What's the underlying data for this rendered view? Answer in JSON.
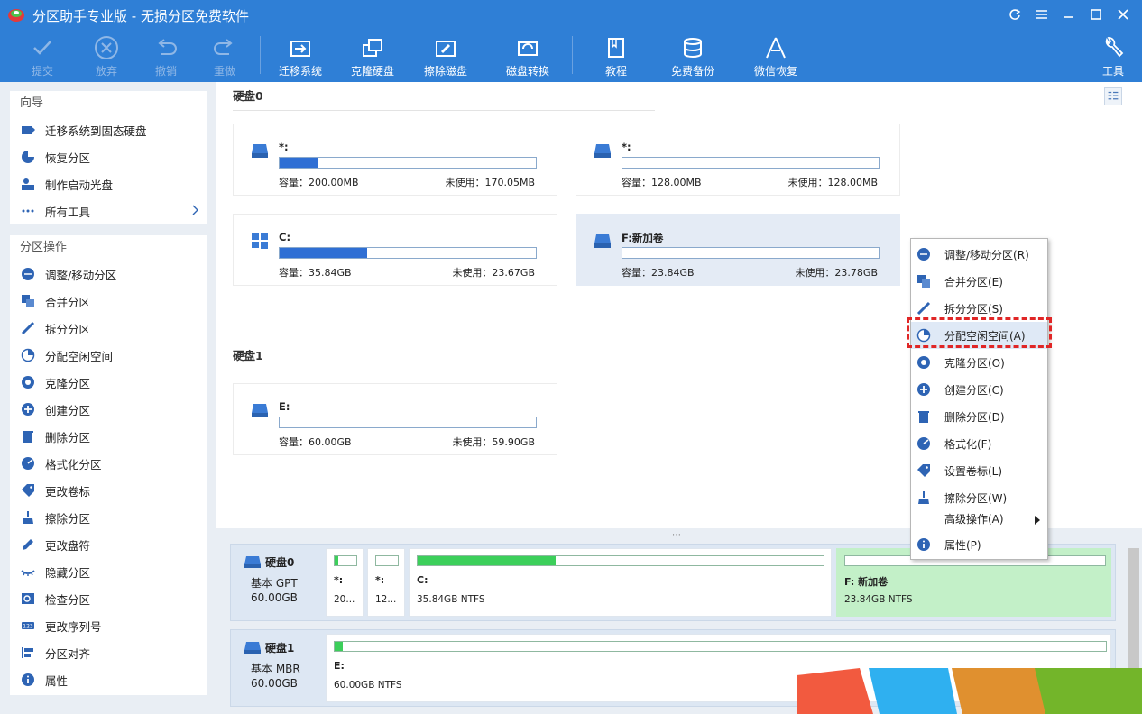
{
  "app": {
    "title": "分区助手专业版 - 无损分区免费软件"
  },
  "toolbar": {
    "commit": "提交",
    "discard": "放弃",
    "undo": "撤销",
    "redo": "重做",
    "migrate": "迁移系统",
    "clone_disk": "克隆硬盘",
    "wipe_disk": "擦除磁盘",
    "convert_disk": "磁盘转换",
    "tutorial": "教程",
    "backup": "免费备份",
    "wechat_recover": "微信恢复",
    "tools": "工具"
  },
  "sidebar": {
    "wizard": {
      "header": "向导",
      "items": [
        {
          "label": "迁移系统到固态硬盘",
          "icon": "migrate-icon"
        },
        {
          "label": "恢复分区",
          "icon": "recover-icon"
        },
        {
          "label": "制作启动光盘",
          "icon": "bootdisk-icon"
        },
        {
          "label": "所有工具",
          "icon": "tools-icon"
        }
      ]
    },
    "ops": {
      "header": "分区操作",
      "items": [
        {
          "label": "调整/移动分区"
        },
        {
          "label": "合并分区"
        },
        {
          "label": "拆分分区"
        },
        {
          "label": "分配空闲空间"
        },
        {
          "label": "克隆分区"
        },
        {
          "label": "创建分区"
        },
        {
          "label": "删除分区"
        },
        {
          "label": "格式化分区"
        },
        {
          "label": "更改卷标"
        },
        {
          "label": "擦除分区"
        },
        {
          "label": "更改盘符"
        },
        {
          "label": "隐藏分区"
        },
        {
          "label": "检查分区"
        },
        {
          "label": "更改序列号"
        },
        {
          "label": "分区对齐"
        },
        {
          "label": "属性"
        }
      ]
    }
  },
  "disk0": {
    "label": "硬盘0",
    "cards": [
      {
        "name": "*:",
        "capacity": "容量：200.00MB",
        "free": "未使用：170.05MB",
        "used_fraction": 0.15
      },
      {
        "name": "*:",
        "capacity": "容量：128.00MB",
        "free": "未使用：128.00MB",
        "used_fraction": 0.0
      },
      {
        "name": "C:",
        "capacity": "容量：35.84GB",
        "free": "未使用：23.67GB",
        "used_fraction": 0.34
      },
      {
        "name": "F:新加卷",
        "capacity": "容量：23.84GB",
        "free": "未使用：23.78GB",
        "used_fraction": 0.0
      }
    ]
  },
  "disk1": {
    "label": "硬盘1",
    "cards": [
      {
        "name": "E:",
        "capacity": "容量：60.00GB",
        "free": "未使用：59.90GB",
        "used_fraction": 0.0
      }
    ]
  },
  "diskmap": {
    "disk0": {
      "name": "硬盘0",
      "type": "基本 GPT",
      "size": "60.00GB",
      "parts": [
        {
          "name": "*:",
          "info": "20...",
          "used_fraction": 0.15
        },
        {
          "name": "*:",
          "info": "12...",
          "used_fraction": 0.0
        },
        {
          "name": "C:",
          "info": "35.84GB NTFS",
          "used_fraction": 0.34
        },
        {
          "name": "F: 新加卷",
          "info": "23.84GB NTFS",
          "used_fraction": 0.0
        }
      ]
    },
    "disk1": {
      "name": "硬盘1",
      "type": "基本 MBR",
      "size": "60.00GB",
      "parts": [
        {
          "name": "E:",
          "info": "60.00GB NTFS",
          "used_fraction": 0.01
        }
      ]
    }
  },
  "context_menu": {
    "items": [
      {
        "label": "调整/移动分区(R)"
      },
      {
        "label": "合并分区(E)"
      },
      {
        "label": "拆分分区(S)"
      },
      {
        "label": "分配空闲空间(A)"
      },
      {
        "label": "克隆分区(O)"
      },
      {
        "label": "创建分区(C)"
      },
      {
        "label": "删除分区(D)"
      },
      {
        "label": "格式化(F)"
      },
      {
        "label": "设置卷标(L)"
      },
      {
        "label": "擦除分区(W)"
      },
      {
        "label": "高级操作(A)"
      },
      {
        "label": "属性(P)"
      }
    ]
  },
  "colors": {
    "accent": "#2f7fd6",
    "used_bar": "#2f6fd4",
    "map_used": "#3ccf5a",
    "highlight": "#e02626"
  }
}
